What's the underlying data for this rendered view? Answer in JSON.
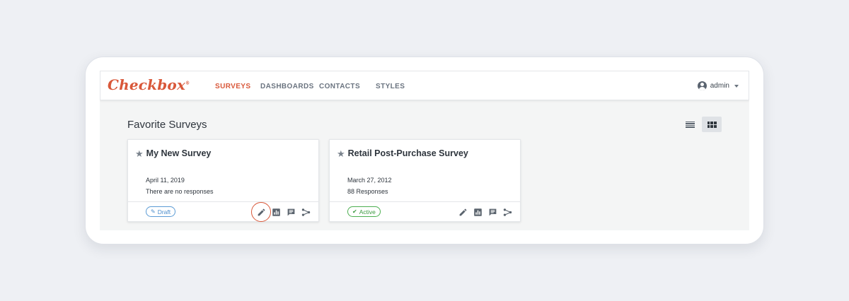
{
  "app": {
    "logo_text": "Checkbox",
    "logo_mark": "®",
    "accent_color": "#d9583a"
  },
  "nav": {
    "items": [
      {
        "label": "SURVEYS",
        "active": true
      },
      {
        "label": "DASHBOARDS",
        "active": false
      },
      {
        "label": "CONTACTS",
        "active": false
      },
      {
        "label": "STYLES",
        "active": false
      }
    ]
  },
  "user": {
    "name": "admin",
    "icon": "user-circle-icon"
  },
  "page": {
    "title": "Favorite Surveys",
    "view_modes": [
      "list",
      "grid"
    ],
    "active_view": "grid"
  },
  "cards": [
    {
      "title": "My New Survey",
      "date": "April 11, 2019",
      "responses": "There are no responses",
      "status": "Draft",
      "status_color": "#4a8ccc",
      "highlighted_action": "edit"
    },
    {
      "title": "Retail Post-Purchase Survey",
      "date": "March 27, 2012",
      "responses": "88 Responses",
      "status": "Active",
      "status_color": "#3c9a40"
    }
  ],
  "card_actions": [
    "edit-icon",
    "reports-icon",
    "responses-icon",
    "share-icon"
  ]
}
